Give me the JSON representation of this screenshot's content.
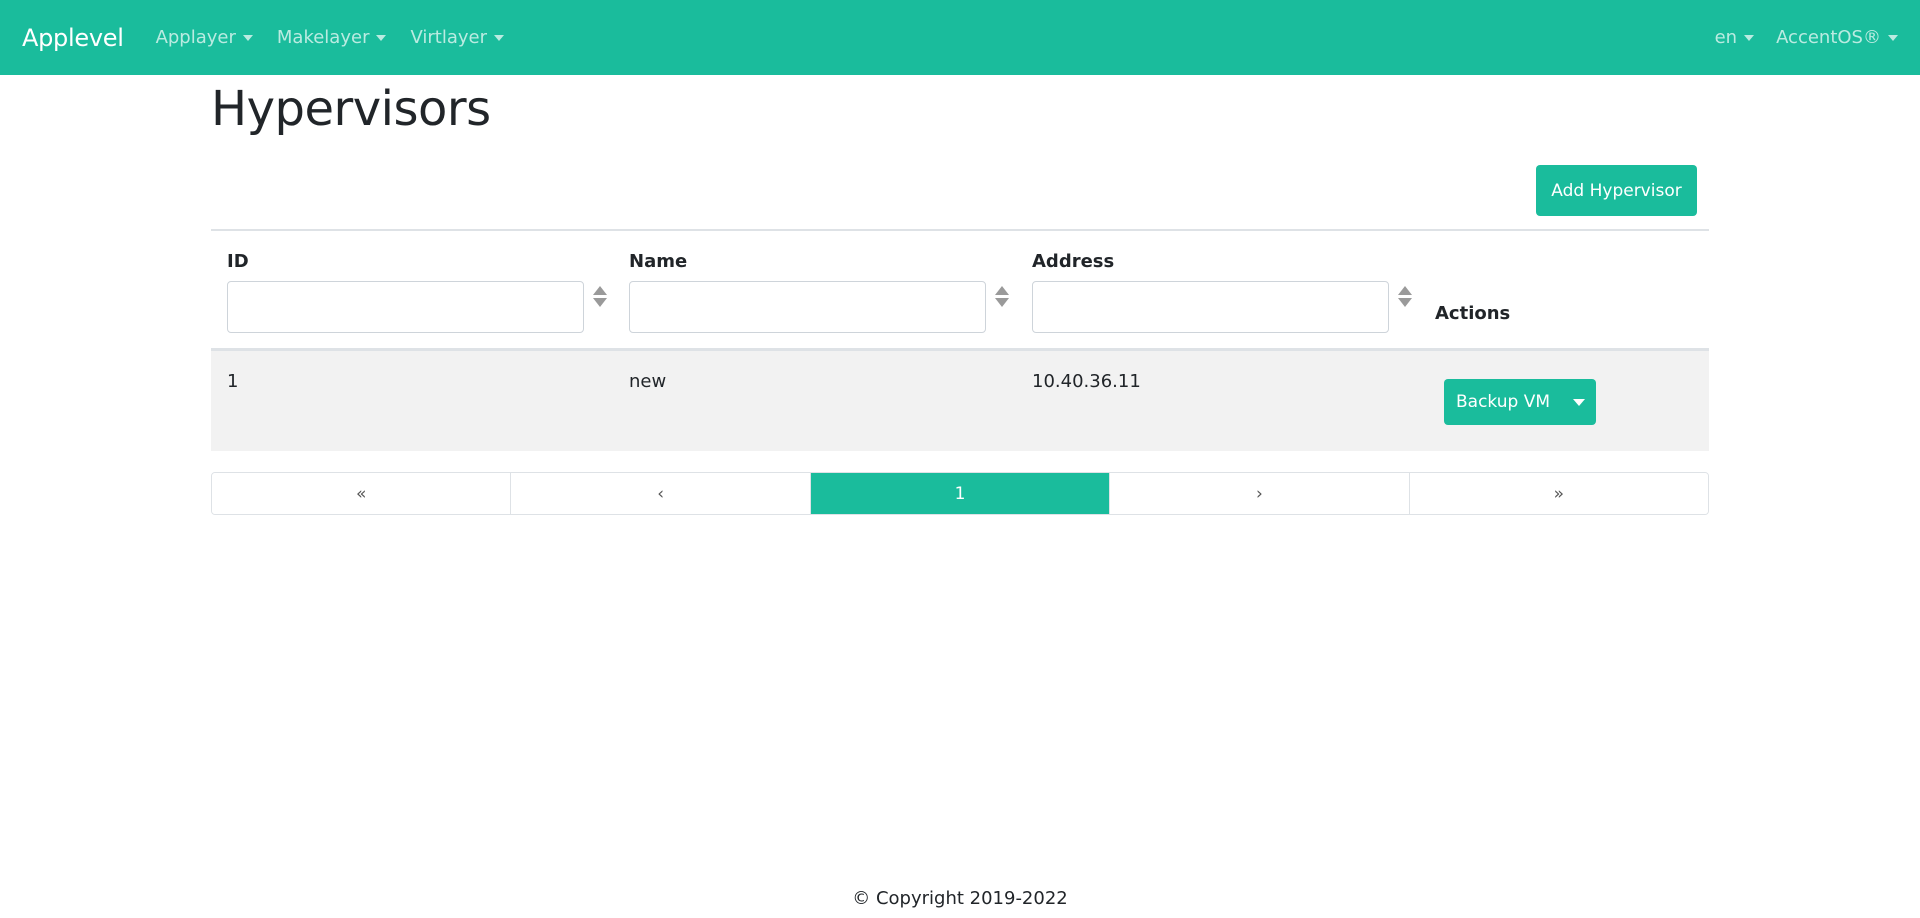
{
  "navbar": {
    "brand": "Applevel",
    "menus": [
      {
        "label": "Applayer"
      },
      {
        "label": "Makelayer"
      },
      {
        "label": "Virtlayer"
      }
    ],
    "language": "en",
    "account": "AccentOS®"
  },
  "page": {
    "title": "Hypervisors",
    "add_button": "Add Hypervisor"
  },
  "table": {
    "columns": {
      "id": "ID",
      "name": "Name",
      "address": "Address",
      "actions": "Actions"
    },
    "filters": {
      "id": "",
      "name": "",
      "address": ""
    },
    "rows": [
      {
        "id": "1",
        "name": "new",
        "address": "10.40.36.11",
        "action_label": "Backup VM"
      }
    ]
  },
  "pagination": {
    "first": "«",
    "prev": "‹",
    "current": "1",
    "next": "›",
    "last": "»"
  },
  "footer": {
    "copyright": "© Copyright 2019-2022"
  },
  "colors": {
    "accent": "#1abc9c",
    "row_bg": "#f2f2f2"
  }
}
